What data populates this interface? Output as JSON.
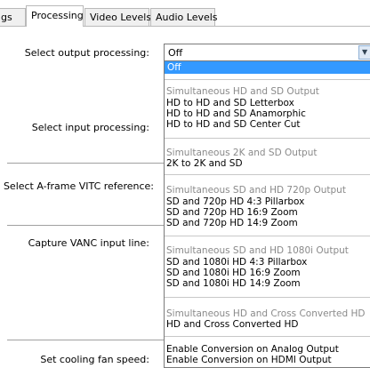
{
  "tabs": [
    {
      "label": "gs",
      "active": false
    },
    {
      "label": "Processing",
      "active": true
    },
    {
      "label": "Video Levels",
      "active": false
    },
    {
      "label": "Audio Levels",
      "active": false
    }
  ],
  "settings": {
    "output_processing": "Select output processing:",
    "input_processing": "Select input processing:",
    "aframe_vitc": "Select A-frame VITC reference:",
    "capture_vanc": "Capture VANC input line:",
    "cooling_fan": "Set cooling fan speed:"
  },
  "combo": {
    "value": "Off",
    "arrow_icon": "chevron-down-icon"
  },
  "dropdown": {
    "selected": "Off",
    "groups": [
      {
        "header": "Simultaneous HD and SD Output",
        "items": [
          "HD to HD and SD Letterbox",
          "HD to HD and SD Anamorphic",
          "HD to HD and SD Center Cut"
        ]
      },
      {
        "header": "Simultaneous 2K and SD Output",
        "items": [
          "2K to 2K and SD"
        ]
      },
      {
        "header": "Simultaneous SD and HD 720p Output",
        "items": [
          "SD and 720p HD 4:3 Pillarbox",
          "SD and 720p HD 16:9 Zoom",
          "SD and 720p HD 14:9 Zoom"
        ]
      },
      {
        "header": "Simultaneous SD and HD 1080i Output",
        "items": [
          "SD and 1080i HD 4:3 Pillarbox",
          "SD and 1080i HD 16:9 Zoom",
          "SD and 1080i HD 14:9 Zoom"
        ]
      },
      {
        "header": "Simultaneous HD and Cross Converted HD",
        "items": [
          "HD and Cross Converted HD"
        ]
      },
      {
        "header": "",
        "items": [
          "Enable Conversion on Analog Output",
          "Enable Conversion on HDMI Output"
        ]
      }
    ]
  },
  "colors": {
    "selection": "#3399ff",
    "group_header": "#8a8a8a",
    "border": "#7a7a7a"
  }
}
